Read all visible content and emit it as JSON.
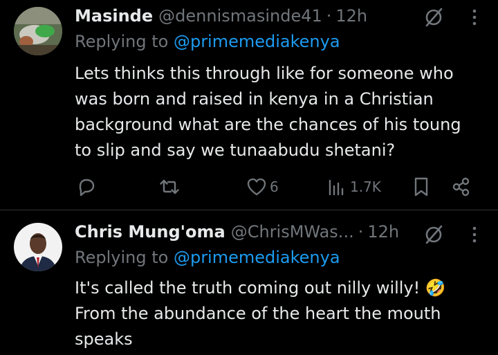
{
  "tweets": [
    {
      "name": "Masinde",
      "handle": "@dennismasinde41",
      "separator": "·",
      "time": "12h",
      "replying_prefix": "Replying to",
      "replying_to": "@primemediakenya",
      "body_lines": [
        "Lets thinks this through like for someone who",
        "was born and raised in kenya in a Christian",
        "background what are the chances of his toung",
        "to slip and say we tunaabudu shetani?"
      ],
      "likes": "6",
      "views": "1.7K"
    },
    {
      "name": "Chris Mung'oma",
      "handle": "@ChrisMWas...",
      "separator": "·",
      "time": "12h",
      "replying_prefix": "Replying to",
      "replying_to": "@primemediakenya",
      "body_lines": [
        "It's called the truth coming out nilly willy! 🤣",
        "From the abundance of the heart the mouth",
        "speaks"
      ]
    }
  ],
  "colors": {
    "background": "#000000",
    "text": "#e7e9ea",
    "muted": "#71767b",
    "link": "#1d9bf0",
    "divider": "#2f3336"
  },
  "icons": [
    "grok-icon",
    "more-icon",
    "reply-icon",
    "retweet-icon",
    "like-icon",
    "views-icon",
    "bookmark-icon",
    "share-icon"
  ]
}
